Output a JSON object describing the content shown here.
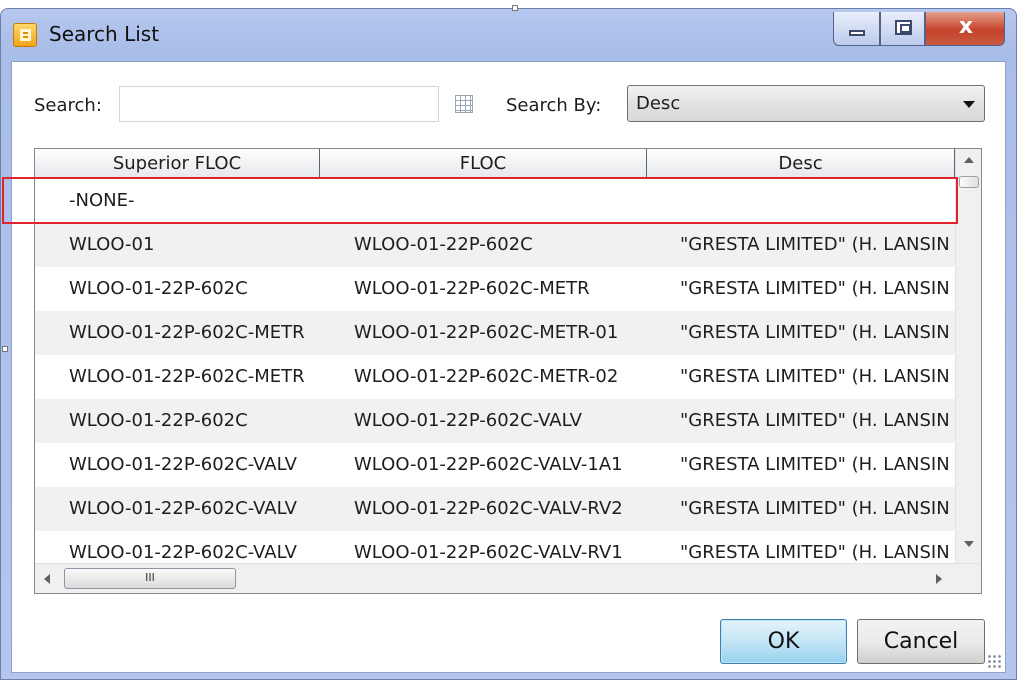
{
  "window": {
    "title": "Search List"
  },
  "search": {
    "label": "Search:",
    "value": "",
    "placeholder": "",
    "search_by_label": "Search By:",
    "search_by_value": "Desc"
  },
  "table": {
    "columns": [
      "Superior FLOC",
      "FLOC",
      "Desc"
    ],
    "rows": [
      {
        "superior": "-NONE-",
        "floc": "",
        "desc": ""
      },
      {
        "superior": "WLOO-01",
        "floc": "WLOO-01-22P-602C",
        "desc": "\"GRESTA LIMITED\"  (H. LANSIN"
      },
      {
        "superior": "WLOO-01-22P-602C",
        "floc": "WLOO-01-22P-602C-METR",
        "desc": "\"GRESTA LIMITED\"  (H. LANSIN"
      },
      {
        "superior": "WLOO-01-22P-602C-METR",
        "floc": "WLOO-01-22P-602C-METR-01",
        "desc": "\"GRESTA LIMITED\"  (H. LANSIN"
      },
      {
        "superior": "WLOO-01-22P-602C-METR",
        "floc": "WLOO-01-22P-602C-METR-02",
        "desc": "\"GRESTA LIMITED\"  (H. LANSIN"
      },
      {
        "superior": "WLOO-01-22P-602C",
        "floc": "WLOO-01-22P-602C-VALV",
        "desc": "\"GRESTA LIMITED\"  (H. LANSIN"
      },
      {
        "superior": "WLOO-01-22P-602C-VALV",
        "floc": "WLOO-01-22P-602C-VALV-1A1",
        "desc": "\"GRESTA LIMITED\"  (H. LANSIN"
      },
      {
        "superior": "WLOO-01-22P-602C-VALV",
        "floc": "WLOO-01-22P-602C-VALV-RV2",
        "desc": "\"GRESTA LIMITED\"  (H. LANSIN"
      },
      {
        "superior": "WLOO-01-22P-602C-VALV",
        "floc": "WLOO-01-22P-602C-VALV-RV1",
        "desc": "\"GRESTA LIMITED\"  (H. LANSIN"
      }
    ],
    "hscroll_grip": "III"
  },
  "buttons": {
    "ok": "OK",
    "cancel": "Cancel",
    "close_glyph": "x"
  },
  "colors": {
    "highlight": "#e0232e",
    "ok_accent": "#3c7fb1",
    "titlebar": "#a9bde9"
  },
  "icons": [
    "app-icon",
    "minimize-icon",
    "maximize-icon",
    "close-icon",
    "grid-picker-icon",
    "dropdown-arrow-icon",
    "scroll-up-icon",
    "scroll-down-icon",
    "scroll-left-icon",
    "scroll-right-icon",
    "resize-grip-icon"
  ]
}
